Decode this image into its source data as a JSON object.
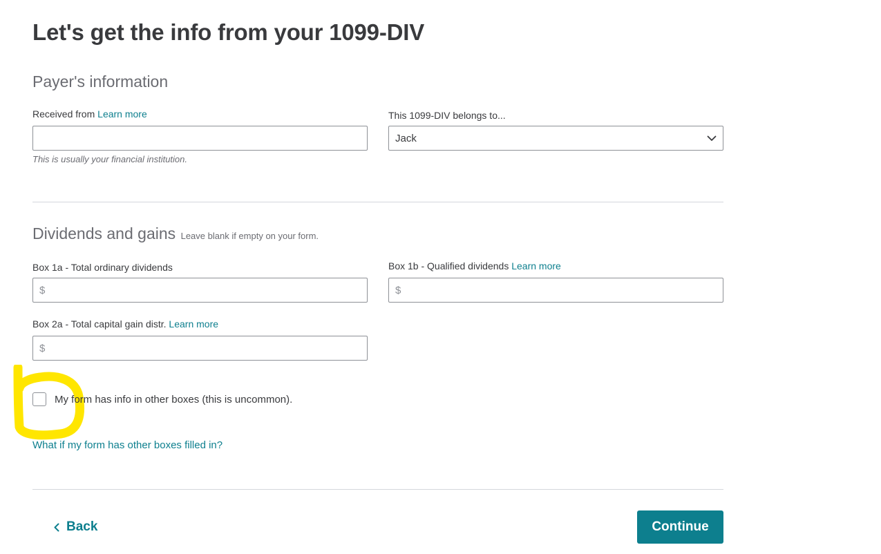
{
  "page": {
    "title": "Let's get the info from your 1099-DIV"
  },
  "payer_section": {
    "title": "Payer's information",
    "received_from": {
      "label": "Received from",
      "learn_more": "Learn more",
      "value": "",
      "help_text": "This is usually your financial institution."
    },
    "belongs_to": {
      "label": "This 1099-DIV belongs to...",
      "selected": "Jack",
      "icon": "chevron-down-icon"
    }
  },
  "dividends_section": {
    "title": "Dividends and gains",
    "note": "Leave blank if empty on your form.",
    "box_1a": {
      "label": "Box 1a - Total ordinary dividends",
      "prefix": "$",
      "value": ""
    },
    "box_1b": {
      "label": "Box 1b - Qualified dividends",
      "learn_more": "Learn more",
      "prefix": "$",
      "value": ""
    },
    "box_2a": {
      "label": "Box 2a - Total capital gain distr.",
      "learn_more": "Learn more",
      "prefix": "$",
      "value": ""
    }
  },
  "other_boxes": {
    "checkbox_label": "My form has info in other boxes (this is uncommon).",
    "checked": false,
    "faq_link": "What if my form has other boxes filled in?"
  },
  "footer": {
    "back_label": "Back",
    "back_icon": "chevron-left-icon",
    "continue_label": "Continue"
  },
  "colors": {
    "accent": "#0d7f8e",
    "highlight": "#ffe600"
  }
}
